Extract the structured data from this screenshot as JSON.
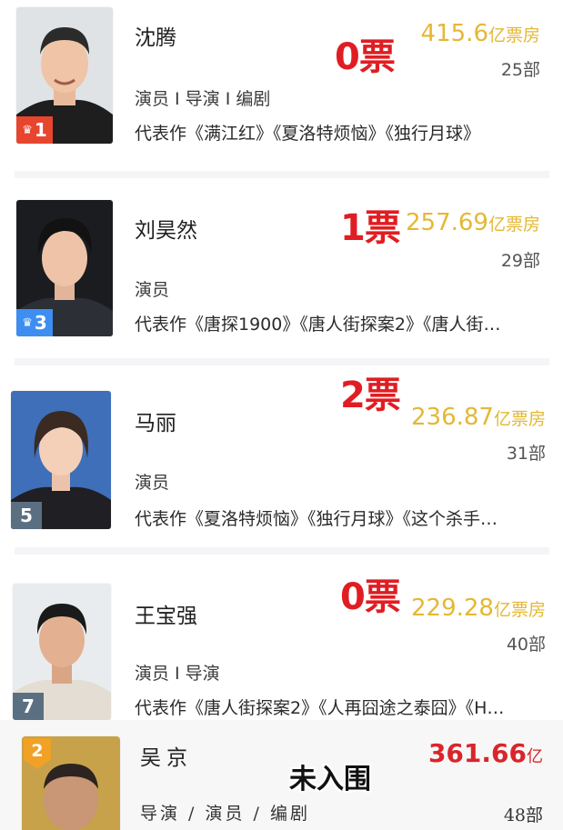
{
  "entries": [
    {
      "name": "沈腾",
      "votes": "0票",
      "box_office": "415.6",
      "box_office_unit": "亿票房",
      "film_count": "25部",
      "roles": "演员 I 导演 I 编剧",
      "works": "代表作《满江红》《夏洛特烦恼》《独行月球》",
      "rank": "1",
      "rank_badge_color": "#e8452f",
      "rank_icon": "crown-icon"
    },
    {
      "name": "刘昊然",
      "votes": "1票",
      "box_office": "257.69",
      "box_office_unit": "亿票房",
      "film_count": "29部",
      "roles": "演员",
      "works": "代表作《唐探1900》《唐人街探案2》《唐人街…",
      "rank": "3",
      "rank_badge_color": "#3d8ef0",
      "rank_icon": "crown-icon"
    },
    {
      "name": "马丽",
      "votes": "2票",
      "box_office": "236.87",
      "box_office_unit": "亿票房",
      "film_count": "31部",
      "roles": "演员",
      "works": "代表作《夏洛特烦恼》《独行月球》《这个杀手…",
      "rank": "5",
      "rank_badge_color": "#5b6f82"
    },
    {
      "name": "王宝强",
      "votes": "0票",
      "box_office": "229.28",
      "box_office_unit": "亿票房",
      "film_count": "40部",
      "roles": "演员 I 导演",
      "works": "代表作《唐人街探案2》《人再囧途之泰囧》《H…",
      "rank": "7",
      "rank_badge_color": "#5b6f82"
    }
  ],
  "bottom_entry": {
    "name": "吴京",
    "box_office": "361.66",
    "box_office_unit": "亿",
    "roles": "导演 / 演员 / 编剧",
    "film_count": "48部",
    "rank": "2",
    "rank_badge_color": "#f0a126",
    "note": "未入围"
  },
  "colors": {
    "votes": "#e01d22",
    "box_office": "#e4b833",
    "bottom_box_office": "#d9252b"
  }
}
